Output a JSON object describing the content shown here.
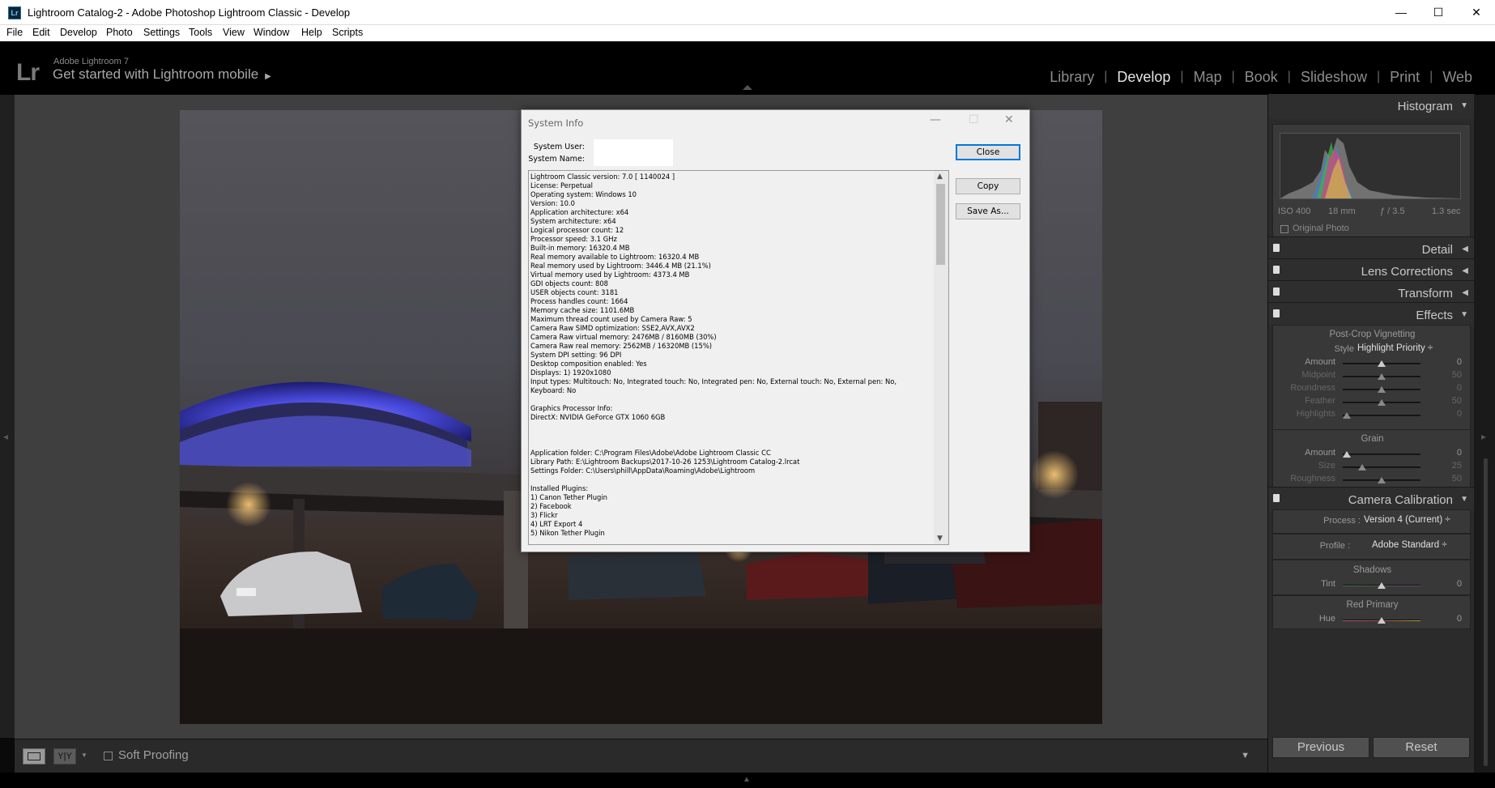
{
  "window": {
    "title": "Lightroom Catalog-2 - Adobe Photoshop Lightroom Classic - Develop",
    "app_badge": "Lr",
    "controls": [
      "—",
      "☐",
      "✕"
    ]
  },
  "menu": [
    "File",
    "Edit",
    "Develop",
    "Photo",
    "Settings",
    "Tools",
    "View",
    "Window",
    "Help",
    "Scripts"
  ],
  "identity": {
    "logo": "Lr",
    "small": "Adobe Lightroom 7",
    "big": "Get started with Lightroom mobile",
    "arrow": "▶"
  },
  "modules": [
    "Library",
    "Develop",
    "Map",
    "Book",
    "Slideshow",
    "Print",
    "Web"
  ],
  "active_module": "Develop",
  "dialog": {
    "title": "System Info",
    "controls": [
      "—",
      "☐",
      "✕"
    ],
    "system_user_label": "System User:",
    "system_name_label": "System Name:",
    "buttons": {
      "close": "Close",
      "copy": "Copy",
      "save_as": "Save As..."
    },
    "info_lines": [
      "Lightroom Classic version: 7.0 [ 1140024 ]",
      "License: Perpetual",
      "Operating system: Windows 10",
      "Version: 10.0",
      "Application architecture: x64",
      "System architecture: x64",
      "Logical processor count: 12",
      "Processor speed: 3.1 GHz",
      "Built-in memory: 16320.4 MB",
      "Real memory available to Lightroom: 16320.4 MB",
      "Real memory used by Lightroom: 3446.4 MB (21.1%)",
      "Virtual memory used by Lightroom: 4373.4 MB",
      "GDI objects count: 808",
      "USER objects count: 3181",
      "Process handles count: 1664",
      "Memory cache size: 1101.6MB",
      "Maximum thread count used by Camera Raw: 5",
      "Camera Raw SIMD optimization: SSE2,AVX,AVX2",
      "Camera Raw virtual memory: 2476MB / 8160MB (30%)",
      "Camera Raw real memory: 2562MB / 16320MB (15%)",
      "System DPI setting: 96 DPI",
      "Desktop composition enabled: Yes",
      "Displays: 1) 1920x1080",
      "Input types: Multitouch: No, Integrated touch: No, Integrated pen: No, External touch: No, External pen: No,",
      "Keyboard: No",
      "",
      "Graphics Processor Info:",
      "DirectX: NVIDIA GeForce GTX 1060 6GB",
      "",
      "",
      "",
      "Application folder: C:\\Program Files\\Adobe\\Adobe Lightroom Classic CC",
      "Library Path: E:\\Lightroom Backups\\2017-10-26 1253\\Lightroom Catalog-2.lrcat",
      "Settings Folder: C:\\Users\\phill\\AppData\\Roaming\\Adobe\\Lightroom",
      "",
      "Installed Plugins:",
      "1) Canon Tether Plugin",
      "2) Facebook",
      "3) Flickr",
      "4) LRT Export 4",
      "5) Nikon Tether Plugin"
    ]
  },
  "toolbar": {
    "yy_label": "Y|Y",
    "soft_proofing": "Soft Proofing",
    "menu_arrow": "▼"
  },
  "right_panel": {
    "histogram": {
      "title": "Histogram",
      "iso": "ISO 400",
      "focal": "18 mm",
      "aperture": "ƒ / 3.5",
      "shutter": "1.3 sec",
      "original_photo": "Original Photo"
    },
    "panels": {
      "detail": "Detail",
      "lens": "Lens Corrections",
      "transform": "Transform",
      "effects": "Effects",
      "calibration": "Camera Calibration"
    },
    "vignetting": {
      "title": "Post-Crop Vignetting",
      "style_label": "Style",
      "style_value": "Highlight Priority ÷",
      "sliders": [
        {
          "label": "Amount",
          "value": "0",
          "pos": 0.5,
          "dim": false
        },
        {
          "label": "Midpoint",
          "value": "50",
          "pos": 0.5,
          "dim": true
        },
        {
          "label": "Roundness",
          "value": "0",
          "pos": 0.5,
          "dim": true
        },
        {
          "label": "Feather",
          "value": "50",
          "pos": 0.5,
          "dim": true
        },
        {
          "label": "Highlights",
          "value": "0",
          "pos": 0.05,
          "dim": true
        }
      ]
    },
    "grain": {
      "title": "Grain",
      "sliders": [
        {
          "label": "Amount",
          "value": "0",
          "pos": 0.05,
          "dim": false
        },
        {
          "label": "Size",
          "value": "25",
          "pos": 0.25,
          "dim": true
        },
        {
          "label": "Roughness",
          "value": "50",
          "pos": 0.5,
          "dim": true
        }
      ]
    },
    "calibration": {
      "process_label": "Process :",
      "process_value": "Version 4 (Current) ÷",
      "profile_label": "Profile :",
      "profile_value": "Adobe Standard ÷",
      "shadows_title": "Shadows",
      "tint_label": "Tint",
      "tint_value": "0",
      "tint_pos": 0.5,
      "red_title": "Red Primary",
      "hue_label": "Hue",
      "hue_value": "0",
      "hue_pos": 0.5
    },
    "previous": "Previous",
    "reset": "Reset"
  },
  "colors": {
    "active_module": "#e6e6e6",
    "inactive_module": "#8d8d8d",
    "focus_blue": "#0078d7"
  }
}
